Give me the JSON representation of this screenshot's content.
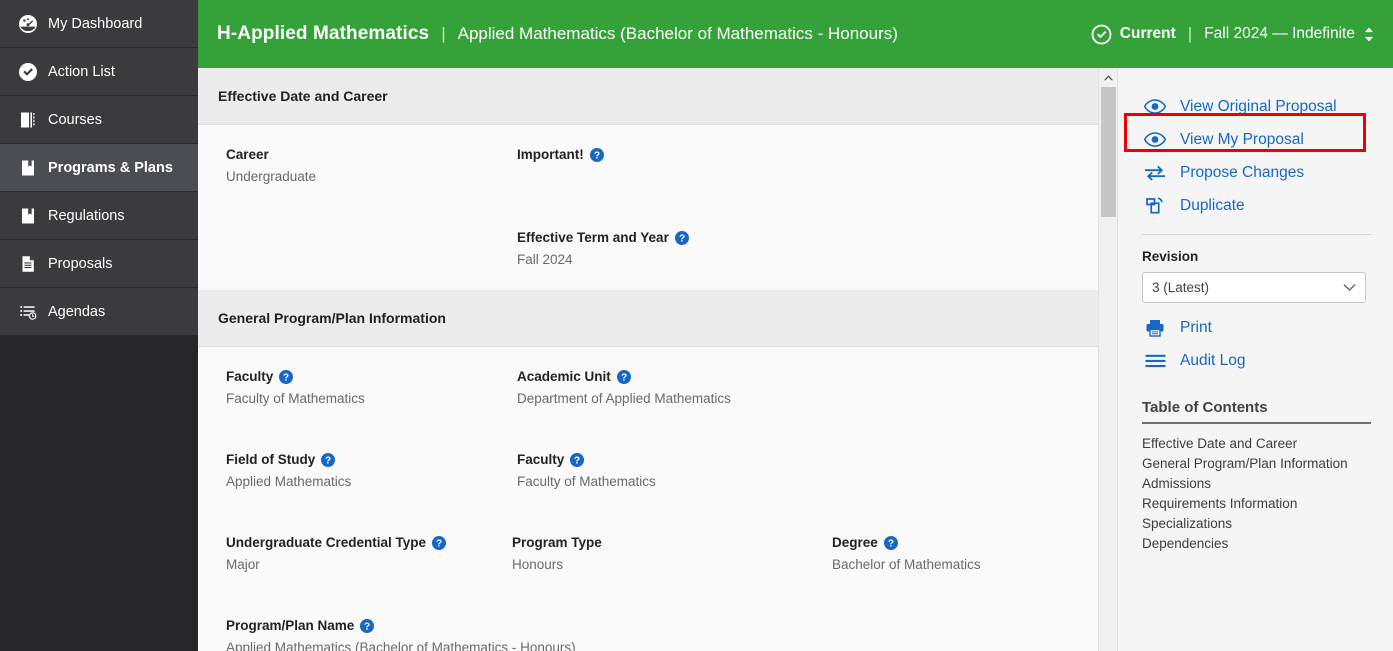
{
  "nav": {
    "items": [
      {
        "label": "My Dashboard",
        "icon": "dashboard-icon",
        "active": false
      },
      {
        "label": "Action List",
        "icon": "check-circle-icon",
        "active": false
      },
      {
        "label": "Courses",
        "icon": "book-icon",
        "active": false
      },
      {
        "label": "Programs & Plans",
        "icon": "book-icon",
        "active": true
      },
      {
        "label": "Regulations",
        "icon": "book-icon",
        "active": false
      },
      {
        "label": "Proposals",
        "icon": "document-icon",
        "active": false
      },
      {
        "label": "Agendas",
        "icon": "agenda-list-icon",
        "active": false
      }
    ]
  },
  "topbar": {
    "code": "H-Applied Mathematics",
    "separator": "|",
    "title": "Applied Mathematics (Bachelor of Mathematics - Honours)",
    "status": "Current",
    "status_icon": "check-circle-icon",
    "term_range": "Fall 2024 — Indefinite",
    "term_caret_icon": "sort-updown-icon",
    "bg_color": "#34a238"
  },
  "main": {
    "sections": [
      {
        "heading": "Effective Date and Career",
        "rows": [
          {
            "fields": [
              {
                "label": "Career",
                "value": "Undergraduate",
                "help": false,
                "col": "col-a"
              },
              {
                "label": "Important!",
                "value": "",
                "help": true,
                "col": "col-d"
              }
            ]
          },
          {
            "fields": [
              {
                "label": "",
                "value": "",
                "help": false,
                "col": "col-a"
              },
              {
                "label": "Effective Term and Year",
                "value": "Fall 2024",
                "help": true,
                "col": "col-d"
              }
            ]
          }
        ]
      },
      {
        "heading": "General Program/Plan Information",
        "rows": [
          {
            "fields": [
              {
                "label": "Faculty",
                "value": "Faculty of Mathematics",
                "help": true,
                "col": "col-a"
              },
              {
                "label": "Academic Unit",
                "value": "Department of Applied Mathematics",
                "help": true,
                "col": "col-d"
              }
            ]
          },
          {
            "fields": [
              {
                "label": "Field of Study",
                "value": "Applied Mathematics",
                "help": true,
                "col": "col-a"
              },
              {
                "label": "Faculty",
                "value": "Faculty of Mathematics",
                "help": true,
                "col": "col-d"
              }
            ]
          },
          {
            "fields": [
              {
                "label": "Undergraduate Credential Type",
                "value": "Major",
                "help": true,
                "col": "col-b"
              },
              {
                "label": "Program Type",
                "value": "Honours",
                "help": false,
                "col": "col-c"
              },
              {
                "label": "Degree",
                "value": "Bachelor of Mathematics",
                "help": true,
                "col": "col-d"
              }
            ]
          },
          {
            "fields": [
              {
                "label": "Program/Plan Name",
                "value": "Applied Mathematics (Bachelor of Mathematics - Honours)",
                "help": true,
                "col": "col-full"
              }
            ]
          }
        ]
      }
    ]
  },
  "scrollbar": {
    "up_icon": "chevron-up-icon"
  },
  "right_panel": {
    "actions": [
      {
        "label": "View Original Proposal",
        "icon": "eye-icon",
        "highlighted": false
      },
      {
        "label": "View My Proposal",
        "icon": "eye-icon",
        "highlighted": true
      },
      {
        "label": "Propose Changes",
        "icon": "exchange-arrows-icon",
        "highlighted": false
      },
      {
        "label": "Duplicate",
        "icon": "duplicate-icon",
        "highlighted": false
      }
    ],
    "revision_label": "Revision",
    "revision_value": "3 (Latest)",
    "revision_caret_icon": "chevron-down-icon",
    "tools": [
      {
        "label": "Print",
        "icon": "printer-icon"
      },
      {
        "label": "Audit Log",
        "icon": "list-lines-icon"
      }
    ],
    "toc_title": "Table of Contents",
    "toc_items": [
      "Effective Date and Career",
      "General Program/Plan Information",
      "Admissions",
      "Requirements Information",
      "Specializations",
      "Dependencies"
    ],
    "highlight_color": "#ee0000",
    "link_color": "#1668c4"
  }
}
